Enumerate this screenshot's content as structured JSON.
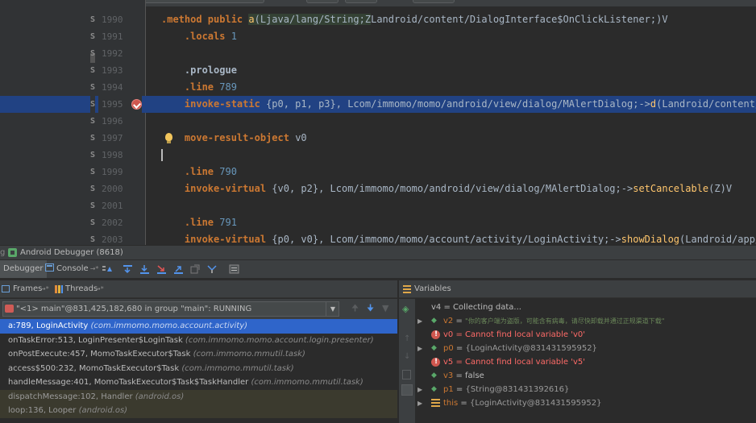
{
  "editor": {
    "lines": [
      {
        "num": "1990",
        "code": ".method public a(Ljava/lang/String;ZLandroid/content/DialogInterface$OnClickListener;)V"
      },
      {
        "num": "1991",
        "code": "    .locals 1"
      },
      {
        "num": "1992",
        "code": ""
      },
      {
        "num": "1993",
        "code": "    .prologue"
      },
      {
        "num": "1994",
        "code": "    .line 789"
      },
      {
        "num": "1995",
        "code": "    invoke-static {p0, p1, p3}, Lcom/immomo/momo/android/view/dialog/MAlertDialog;->d(Landroid/content/Contex"
      },
      {
        "num": "1996",
        "code": ""
      },
      {
        "num": "1997",
        "code": "    move-result-object v0"
      },
      {
        "num": "1998",
        "code": ""
      },
      {
        "num": "1999",
        "code": "    .line 790"
      },
      {
        "num": "2000",
        "code": "    invoke-virtual {v0, p2}, Lcom/immomo/momo/android/view/dialog/MAlertDialog;->setCancelable(Z)V"
      },
      {
        "num": "2001",
        "code": ""
      },
      {
        "num": "2002",
        "code": "    .line 791"
      },
      {
        "num": "2003",
        "code": "    invoke-virtual {p0, v0}, Lcom/immomo/momo/account/activity/LoginActivity;->showDialog(Landroid/app/Dialog"
      }
    ],
    "side_marker": "S",
    "fold_marker": "g"
  },
  "tool_window": {
    "title": "Android Debugger (8618)"
  },
  "tabs": {
    "debugger": "Debugger",
    "console": "Console",
    "pin": "→*"
  },
  "frames_panel": {
    "frames_label": "Frames",
    "threads_label": "Threads",
    "pin": "→*",
    "thread_selector": "\"<1> main\"@831,425,182,680 in group \"main\": RUNNING",
    "frames": [
      {
        "method": "a:789, LoginActivity",
        "package": "(com.immomo.momo.account.activity)"
      },
      {
        "method": "onTaskError:513, LoginPresenter$LoginTask",
        "package": "(com.immomo.momo.account.login.presenter)"
      },
      {
        "method": "onPostExecute:457, MomoTaskExecutor$Task",
        "package": "(com.immomo.mmutil.task)"
      },
      {
        "method": "access$500:232, MomoTaskExecutor$Task",
        "package": "(com.immomo.mmutil.task)"
      },
      {
        "method": "handleMessage:401, MomoTaskExecutor$Task$TaskHandler",
        "package": "(com.immomo.mmutil.task)"
      },
      {
        "method": "dispatchMessage:102, Handler",
        "package": "(android.os)"
      },
      {
        "method": "loop:136, Looper",
        "package": "(android.os)"
      }
    ]
  },
  "variables_panel": {
    "title": "Variables",
    "items": [
      {
        "name": "v4",
        "eq": " = ",
        "value": "Collecting data...",
        "kind": "plain"
      },
      {
        "name": "v2",
        "eq": " = ",
        "value": "\"你的客户端为盗版，可能含有病毒，请尽快卸载并通过正规渠道下载\"",
        "kind": "string"
      },
      {
        "name": "v0",
        "eq": " = ",
        "value": "Cannot find local variable 'v0'",
        "kind": "error"
      },
      {
        "name": "p0",
        "eq": " = ",
        "value": "{LoginActivity@831431595952}",
        "kind": "ref"
      },
      {
        "name": "v5",
        "eq": " = ",
        "value": "Cannot find local variable 'v5'",
        "kind": "error"
      },
      {
        "name": "v3",
        "eq": " = ",
        "value": "false",
        "kind": "value"
      },
      {
        "name": "p1",
        "eq": " = ",
        "value": "{String@831431392616}",
        "kind": "ref"
      },
      {
        "name": "this",
        "eq": " = ",
        "value": "{LoginActivity@831431595952}",
        "kind": "ref"
      }
    ]
  },
  "colors": {
    "editor_bg": "#2b2b2b",
    "selection": "#214283",
    "frame_selected": "#2f65ca",
    "keyword": "#cc7832",
    "error": "#ff6b68"
  }
}
